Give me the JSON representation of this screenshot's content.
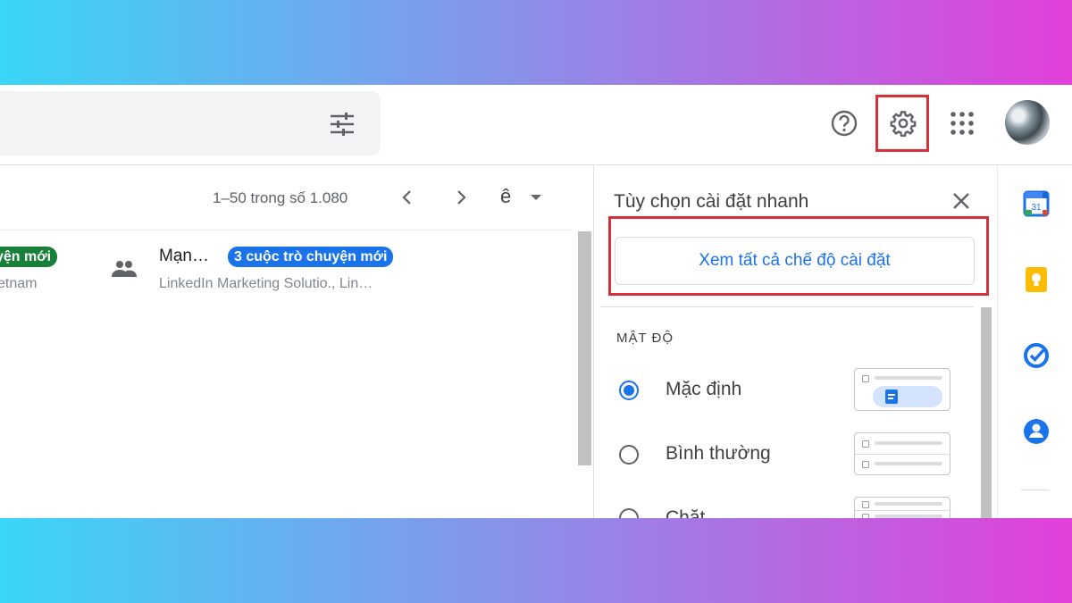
{
  "header": {
    "icons": {
      "filter": "tune-icon",
      "help": "help-circle-icon",
      "settings": "gear-icon",
      "apps": "apps-grid-icon",
      "avatar": "user-avatar"
    }
  },
  "toolbar": {
    "pagination": "1–50 trong số 1.080",
    "input_tools_glyph": "ê"
  },
  "mail": {
    "row_left": {
      "chip": "yện mới",
      "snippet": "etnam"
    },
    "row_right": {
      "sender": "Mạn…",
      "chip": "3 cuộc trò chuyện mới",
      "snippet": "LinkedIn Marketing Solutio., Lin…"
    }
  },
  "quick_settings": {
    "title": "Tùy chọn cài đặt nhanh",
    "see_all": "Xem tất cả chế độ cài đặt",
    "density_heading": "MẬT ĐỘ",
    "options": [
      {
        "label": "Mặc định",
        "selected": true
      },
      {
        "label": "Bình thường",
        "selected": false
      },
      {
        "label": "Chặt",
        "selected": false
      }
    ]
  },
  "side_apps": [
    "calendar-icon",
    "keep-icon",
    "tasks-icon",
    "contacts-icon"
  ],
  "colors": {
    "accent": "#1a73e8",
    "highlight": "#d4323a",
    "chip_green": "#188038"
  }
}
